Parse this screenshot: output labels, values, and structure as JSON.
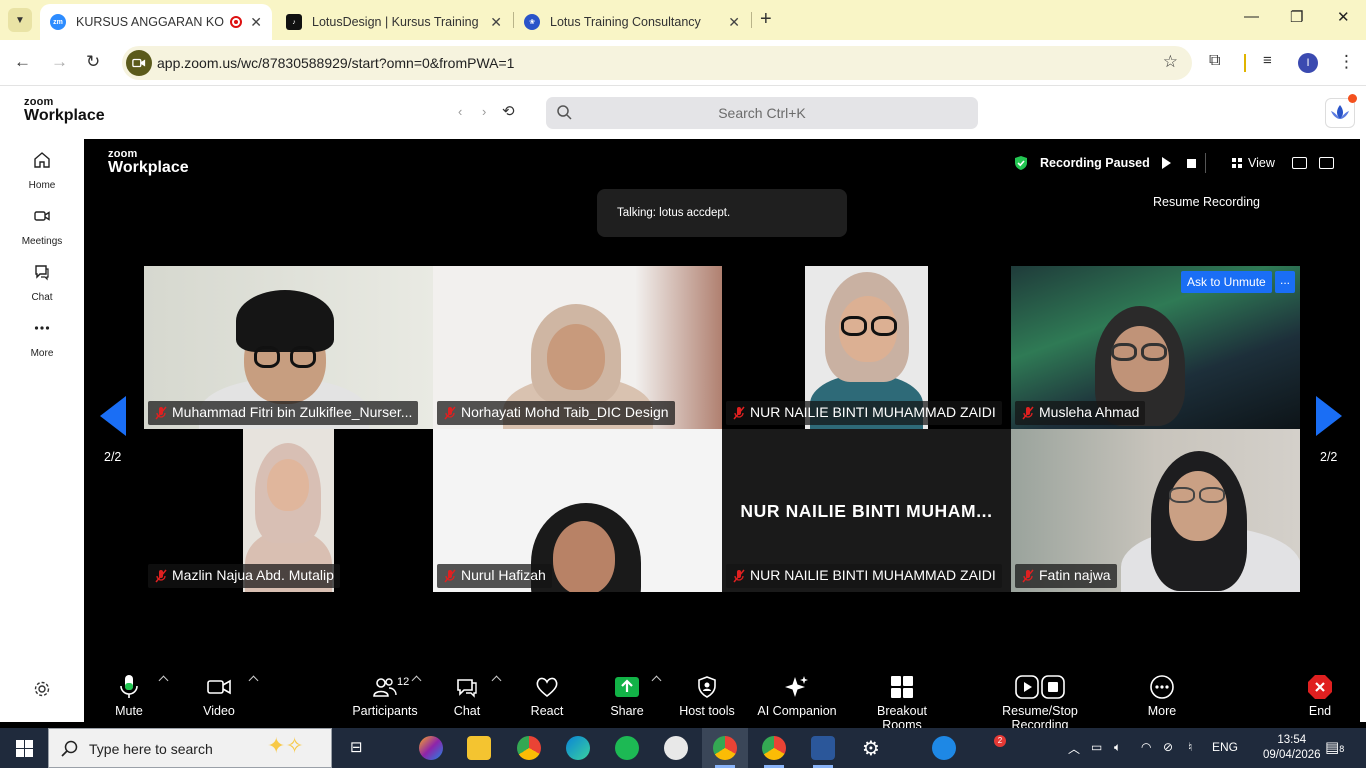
{
  "browser": {
    "tabs": [
      {
        "title": "KURSUS ANGGARAN KOS D",
        "favicon": "zoom-favicon"
      },
      {
        "title": "LotusDesign | Kursus Training (",
        "favicon": "tiktok-favicon"
      },
      {
        "title": "Lotus Training Consultancy",
        "favicon": "lotus-favicon"
      }
    ],
    "url": "app.zoom.us/wc/87830588929/start?omn=0&fromPWA=1",
    "profile_initial": "I"
  },
  "zoom_header": {
    "brand_top": "zoom",
    "brand_bottom": "Workplace",
    "search_placeholder": "Search  Ctrl+K"
  },
  "rail": {
    "items": [
      {
        "label": "Home",
        "icon": "home-icon"
      },
      {
        "label": "Meetings",
        "icon": "video-icon"
      },
      {
        "label": "Chat",
        "icon": "chat-icon"
      },
      {
        "label": "More",
        "icon": "more-icon"
      }
    ]
  },
  "meeting": {
    "brand_top": "zoom",
    "brand_bottom": "Workplace",
    "recording_status": "Recording Paused",
    "view_label": "View",
    "resume_recording": "Resume Recording",
    "talking": "Talking: lotus accdept.",
    "page_left": "2/2",
    "page_right": "2/2",
    "ask_to_unmute": "Ask to Unmute",
    "ask_more": "...",
    "participants": [
      {
        "name": "Muhammad Fitri bin Zulkiflee_Nurser..."
      },
      {
        "name": "Norhayati Mohd Taib_DIC Design"
      },
      {
        "name": "NUR NAILIE BINTI MUHAMMAD ZAIDI"
      },
      {
        "name": "Musleha Ahmad"
      },
      {
        "name": "Mazlin Najua Abd. Mutalip"
      },
      {
        "name": "Nurul Hafizah"
      },
      {
        "name": "NUR NAILIE BINTI MUHAMMAD ZAIDI",
        "display_name": "NUR NAILIE BINTI MUHAM..."
      },
      {
        "name": "Fatin najwa"
      }
    ]
  },
  "toolbar": {
    "mute": "Mute",
    "video": "Video",
    "participants": "Participants",
    "participants_count": "12",
    "chat": "Chat",
    "react": "React",
    "share": "Share",
    "host_tools": "Host tools",
    "ai_companion": "AI Companion",
    "breakout_rooms": "Breakout Rooms",
    "resume_stop_recording": "Resume/Stop Recording",
    "more": "More",
    "end": "End"
  },
  "taskbar": {
    "search_placeholder": "Type here to search",
    "language": "ENG",
    "time": "13:54",
    "date": "09/04/2026",
    "notification_badge": "2",
    "action_center_count": "8"
  },
  "colors": {
    "accent_blue": "#1a6ef5",
    "share_green": "#12b347",
    "end_red": "#e02020",
    "tab_strip": "#f9f5c6"
  }
}
